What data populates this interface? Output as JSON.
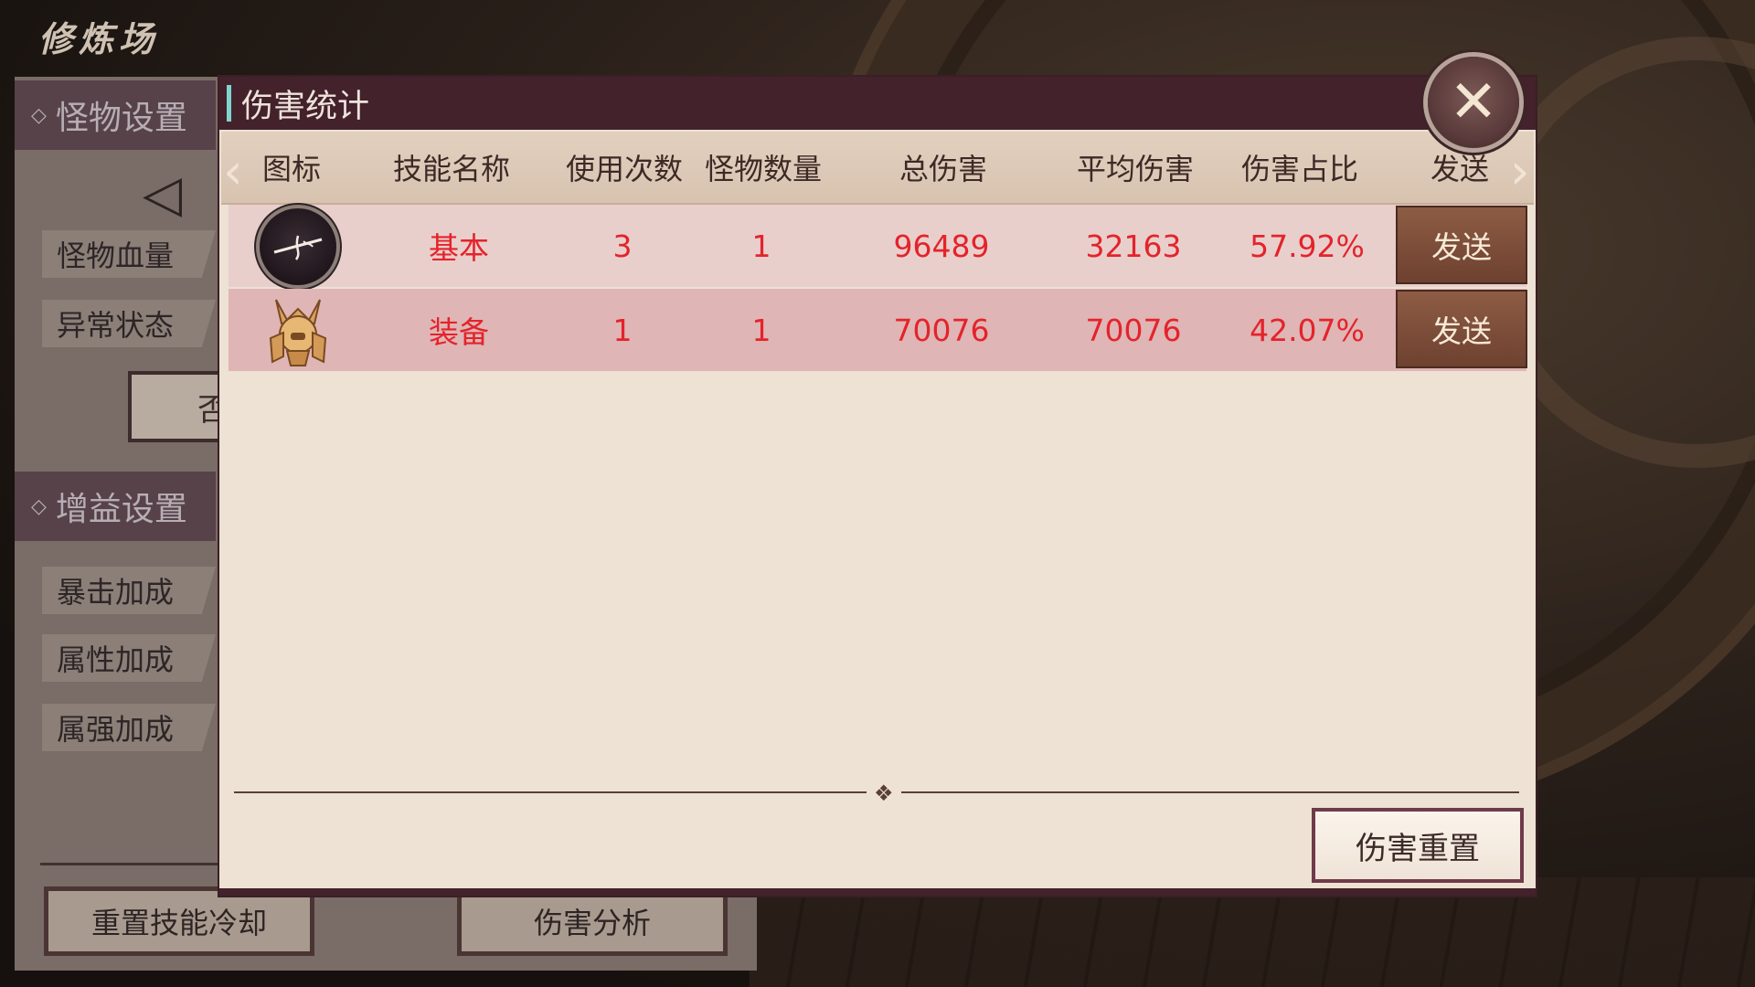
{
  "scene": {
    "title": "修炼场"
  },
  "left_panel": {
    "monster_section": "怪物设置",
    "monster_hp_label": "怪物血量",
    "abnormal_label": "异常状态",
    "no_button_fragment": "否",
    "buff_section": "增益设置",
    "crit_bonus": "暴击加成",
    "attr_bonus": "属性加成",
    "elem_bonus": "属强加成",
    "reset_cd_button": "重置技能冷却",
    "damage_analysis_button": "伤害分析"
  },
  "dialog": {
    "title": "伤害统计",
    "close_glyph": "✕",
    "columns": [
      "图标",
      "技能名称",
      "使用次数",
      "怪物数量",
      "总伤害",
      "平均伤害",
      "伤害占比",
      "发送"
    ],
    "rows": [
      {
        "icon": "sword-slash-icon",
        "skill": "基本",
        "uses": "3",
        "monsters": "1",
        "total": "96489",
        "average": "32163",
        "share": "57.92%",
        "send": "发送"
      },
      {
        "icon": "samurai-helmet-icon",
        "skill": "装备",
        "uses": "1",
        "monsters": "1",
        "total": "70076",
        "average": "70076",
        "share": "42.07%",
        "send": "发送"
      }
    ],
    "reset_button": "伤害重置"
  },
  "colors": {
    "title_bar": "#43222b",
    "value_red": "#e4232b",
    "send_button": "#7a4a36"
  }
}
